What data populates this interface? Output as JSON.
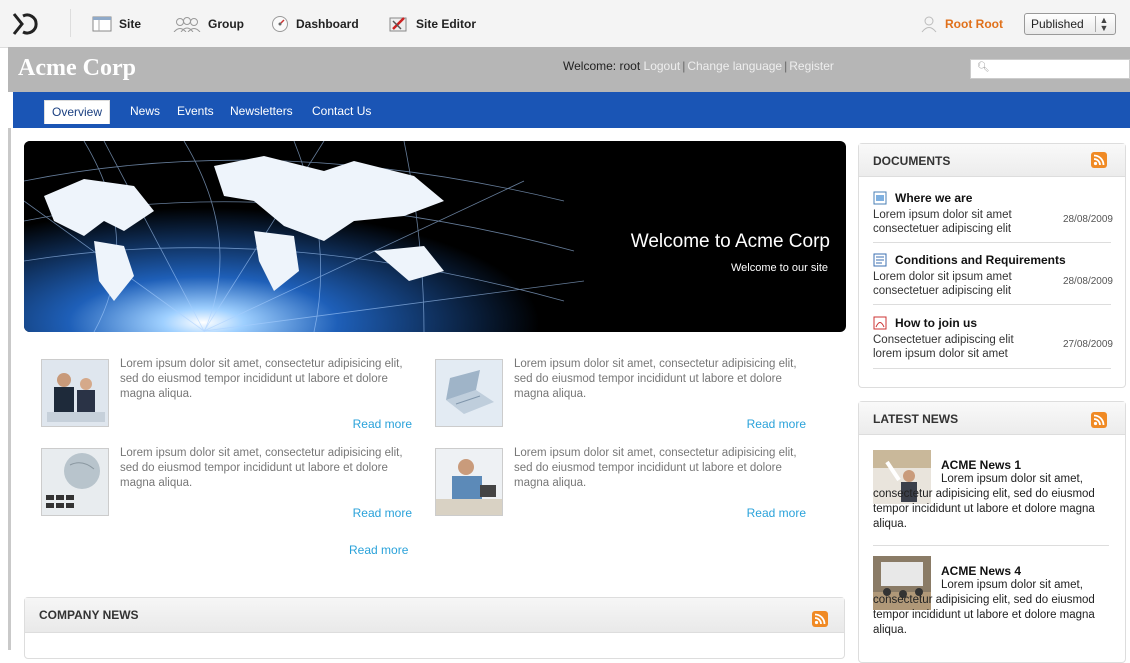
{
  "toolbar": {
    "site": "Site",
    "group": "Group",
    "dashboard": "Dashboard",
    "site_editor": "Site Editor",
    "user": "Root Root",
    "publish_state": "Published"
  },
  "header": {
    "title": "Acme Corp",
    "welcome_label": "Welcome:",
    "welcome_user": "root",
    "logout": "Logout",
    "change_language": "Change language",
    "register": "Register",
    "separator": "|"
  },
  "nav": {
    "items": [
      "Overview",
      "News",
      "Events",
      "Newsletters",
      "Contact Us"
    ],
    "active": "Overview"
  },
  "hero": {
    "title": "Welcome to Acme Corp",
    "subtitle": "Welcome to our site"
  },
  "teasers": [
    {
      "text": "Lorem ipsum dolor sit amet, consectetur adipisicing elit, sed do eiusmod tempor incididunt ut labore et dolore magna aliqua.",
      "read_more": "Read more",
      "image": "business-meeting"
    },
    {
      "text": "Lorem ipsum dolor sit amet, consectetur adipisicing elit, sed do eiusmod tempor incididunt ut labore et dolore magna aliqua.",
      "read_more": "Read more",
      "image": "laptop"
    },
    {
      "text": "Lorem ipsum dolor sit amet, consectetur adipisicing elit, sed do eiusmod tempor incididunt ut labore et dolore magna aliqua.",
      "read_more": "Read more",
      "image": "globe-keyboard"
    },
    {
      "text": "Lorem ipsum dolor sit amet, consectetur adipisicing elit, sed do eiusmod tempor incididunt ut labore et dolore magna aliqua.",
      "read_more": "Read more",
      "image": "man-at-desk"
    }
  ],
  "extra_read_more": "Read more",
  "company_news": {
    "title": "COMPANY NEWS"
  },
  "documents": {
    "title": "DOCUMENTS",
    "items": [
      {
        "title": "Where we are",
        "desc": "Lorem ipsum dolor sit amet consectetuer adipiscing elit",
        "date": "28/08/2009",
        "icon": "image-doc-icon"
      },
      {
        "title": "Conditions and Requirements",
        "desc": "Lorem dolor sit ipsum amet consectetuer adipiscing elit",
        "date": "28/08/2009",
        "icon": "text-doc-icon"
      },
      {
        "title": "How to join us",
        "desc": "Consectetuer adipiscing elit lorem ipsum dolor sit amet",
        "date": "27/08/2009",
        "icon": "pdf-icon"
      }
    ]
  },
  "latest_news": {
    "title": "LATEST NEWS",
    "items": [
      {
        "title": "ACME News 1",
        "desc": "Lorem ipsum dolor sit amet, consectetur adipisicing elit, sed do eiusmod tempor incididunt ut labore et dolore magna aliqua."
      },
      {
        "title": "ACME News 4",
        "desc": "Lorem ipsum dolor sit amet, consectetur adipisicing elit, sed do eiusmod tempor incididunt ut labore et dolore magna aliqua."
      }
    ]
  },
  "colors": {
    "nav_bg": "#1a55b5",
    "header_bg": "#b6b6b6",
    "accent_link": "#2aa2da",
    "rss": "#f08a24",
    "user": "#e0701a"
  }
}
